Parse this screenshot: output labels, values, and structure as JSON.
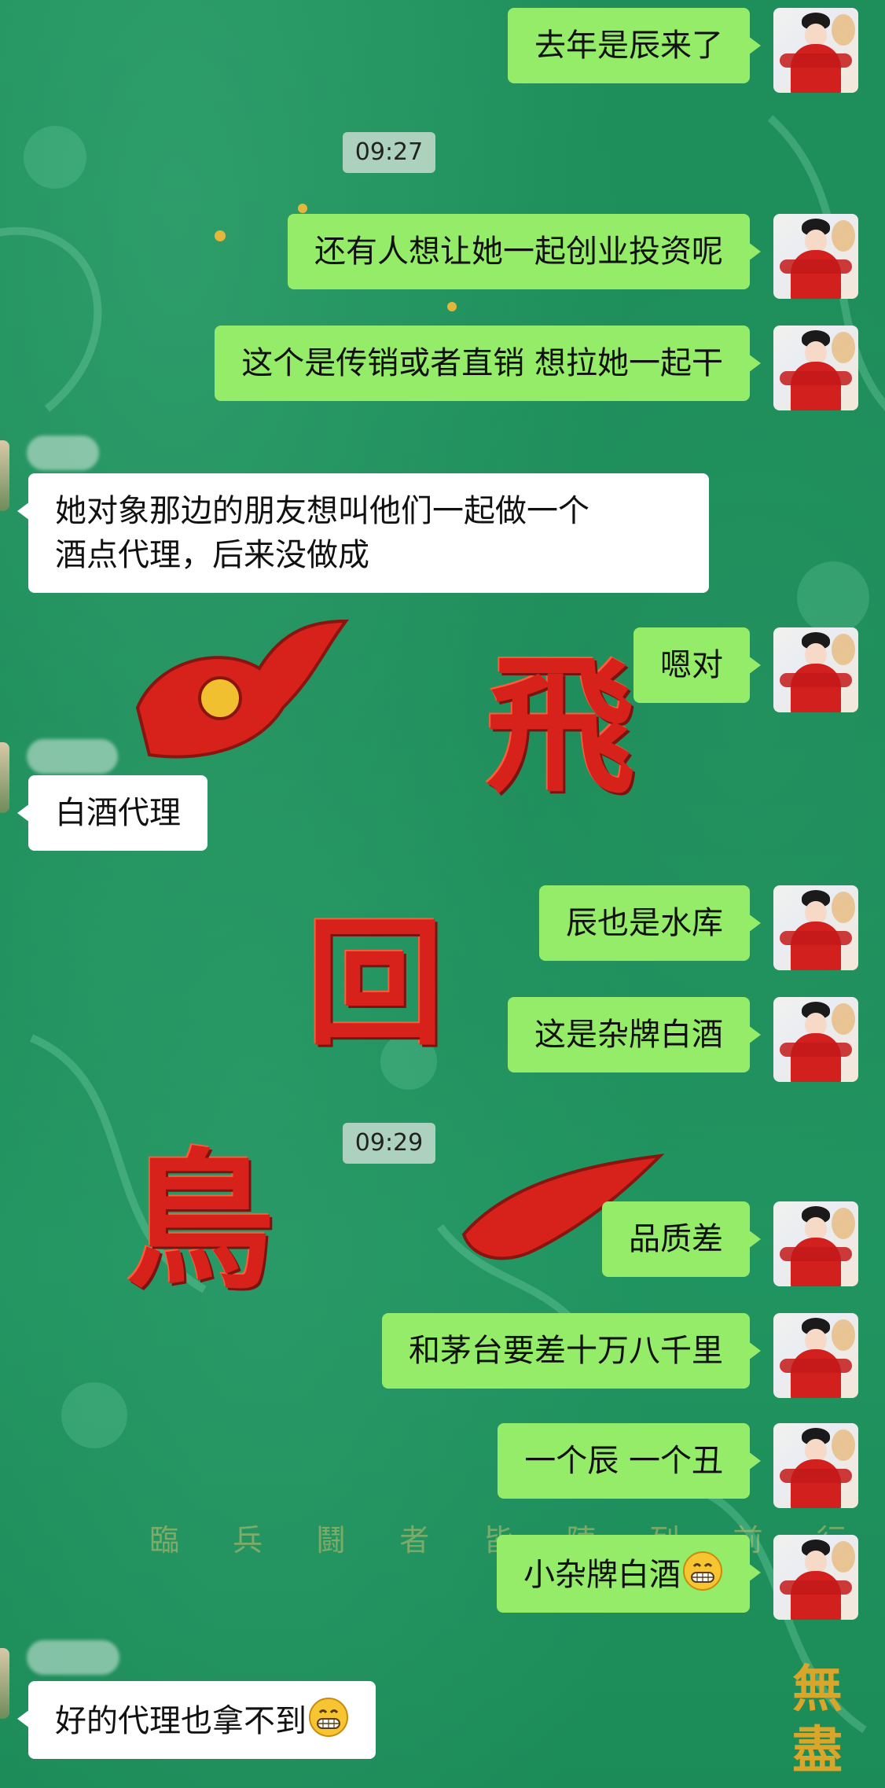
{
  "messages": [
    {
      "id": "m1",
      "side": "me",
      "text": "去年是辰来了"
    },
    {
      "id": "t1",
      "type": "time",
      "text": "09:27"
    },
    {
      "id": "m2",
      "side": "me",
      "text": "还有人想让她一起创业投资呢"
    },
    {
      "id": "m3",
      "side": "me",
      "text": "这个是传销或者直销 想拉她一起干"
    },
    {
      "id": "m4",
      "side": "them",
      "line1": "她对象那边的朋友想叫他们一起做一个",
      "line2": "酒点代理，后来没做成"
    },
    {
      "id": "m5",
      "side": "me",
      "text": "嗯对"
    },
    {
      "id": "m6",
      "side": "them",
      "text": "白酒代理"
    },
    {
      "id": "m7",
      "side": "me",
      "text": "辰也是水库"
    },
    {
      "id": "m8",
      "side": "me",
      "text": "这是杂牌白酒"
    },
    {
      "id": "t2",
      "type": "time",
      "text": "09:29"
    },
    {
      "id": "m9",
      "side": "me",
      "text": "品质差"
    },
    {
      "id": "m10",
      "side": "me",
      "text": "和茅台要差十万八千里"
    },
    {
      "id": "m11",
      "side": "me",
      "text": "一个辰 一个丑"
    },
    {
      "id": "m12",
      "side": "me",
      "text": "小杂牌白酒",
      "emoji": "grin-emoji"
    },
    {
      "id": "m13",
      "side": "them",
      "text": "好的代理也拿不到",
      "emoji": "grin-emoji"
    }
  ],
  "wallpaper": {
    "bottom_text": "臨 兵 鬪 者 皆 陣 列 前 行",
    "corner_text": "無盡"
  },
  "colors": {
    "background": "#1f8f5c",
    "my_bubble": "#95ec69",
    "their_bubble": "#ffffff",
    "glyph_red": "#d6221b"
  }
}
